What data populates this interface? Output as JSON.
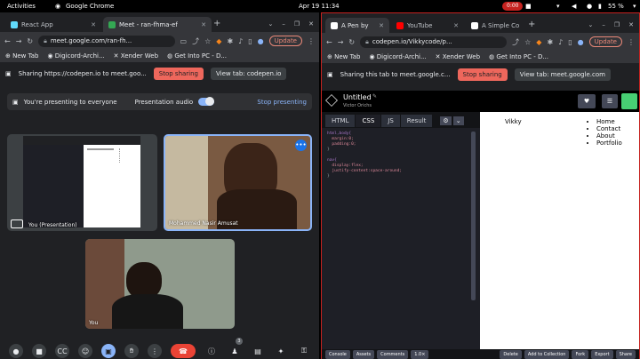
{
  "topbar": {
    "activities": "Activities",
    "app": "Google Chrome",
    "datetime": "Apr 19  11:34",
    "rec": "0:00",
    "battery": "55 %"
  },
  "left": {
    "tabs": [
      {
        "label": "React App",
        "color": "#61dafb"
      },
      {
        "label": "Meet - ran-fhma-ef",
        "color": "#34a853"
      }
    ],
    "url": "meet.google.com/ran-fh...",
    "update": "Update",
    "bookmarks": [
      "New Tab",
      "Digicord-Archi...",
      "Xender Web",
      "Get Into PC - D..."
    ],
    "share_text": "Sharing https://codepen.io to meet.goo...",
    "stop": "Stop sharing",
    "view": "View tab: codepen.io",
    "meet": {
      "presenting": "You're presenting to everyone",
      "audio": "Presentation audio",
      "stop_presenting": "Stop presenting",
      "tiles": [
        "You (Presentation)",
        "Mohammed Nasir Amusat",
        "You"
      ],
      "badge": "3"
    }
  },
  "right": {
    "tabs": [
      {
        "label": "A Pen by",
        "color": "#ffffff"
      },
      {
        "label": "YouTube",
        "color": "#ff0000"
      },
      {
        "label": "A Simple Co",
        "color": "#ffffff"
      }
    ],
    "url": "codepen.io/Vikkycode/p...",
    "update": "Update",
    "bookmarks": [
      "New Tab",
      "Digicord-Archi...",
      "Xender Web",
      "Get Into PC - D..."
    ],
    "share_text": "Sharing this tab to meet.google.c...",
    "stop": "Stop sharing",
    "view": "View tab: meet.google.com",
    "pen": {
      "title": "Untitled",
      "author": "Victor Orichs",
      "tabs": [
        "HTML",
        "CSS",
        "JS",
        "Result"
      ],
      "code": [
        "html,body{",
        "  margin:0;",
        "  padding:0;",
        "}",
        "",
        "nav{",
        "  display:flex;",
        "  justify-content:space-around;",
        "}"
      ],
      "preview": {
        "brand": "Vikky",
        "links": [
          "Home",
          "Contact",
          "About",
          "Portfolio"
        ]
      },
      "footer": [
        "Console",
        "Assets",
        "Comments",
        "1.0×",
        "Delete",
        "Add to Collection",
        "Fork",
        "Export",
        "Share"
      ]
    }
  }
}
